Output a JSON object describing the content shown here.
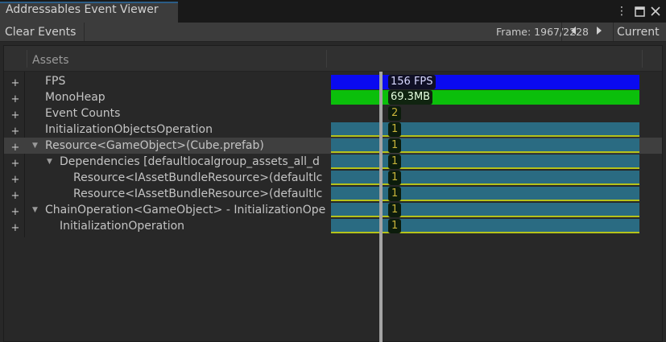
{
  "window": {
    "title": "Addressables Event Viewer",
    "menu_icon": "kebab-menu-icon",
    "maximize_icon": "maximize-icon",
    "close_icon": "close-icon"
  },
  "toolbar": {
    "clear_label": "Clear Events",
    "frame_label": "Frame: 1967/2228",
    "prev_icon": "chevron-left-icon",
    "next_icon": "chevron-right-icon",
    "current_label": "Current"
  },
  "tree": {
    "column_header": "Assets",
    "expand_symbol": "+",
    "rows": [
      {
        "label": "FPS",
        "bar_text": "156 FPS"
      },
      {
        "label": "MonoHeap",
        "bar_text": "69.3MB"
      },
      {
        "label": "Event Counts",
        "bar_text": "2"
      },
      {
        "label": "InitializationObjectsOperation",
        "bar_text": "1"
      },
      {
        "label": "Resource<GameObject>(Cube.prefab)",
        "bar_text": "1"
      },
      {
        "label": "Dependencies [defaultlocalgroup_assets_all_d",
        "bar_text": "1"
      },
      {
        "label": "Resource<IAssetBundleResource>(defaultlc",
        "bar_text": "1"
      },
      {
        "label": "Resource<IAssetBundleResource>(defaultlc",
        "bar_text": "1"
      },
      {
        "label": "ChainOperation<GameObject> - InitializationOpe",
        "bar_text": "1"
      },
      {
        "label": "InitializationOperation",
        "bar_text": "1"
      }
    ]
  },
  "colors": {
    "fps_bar": "#0a0af0",
    "heap_bar": "#0bbf0b",
    "operation_bar": "#2a6b82",
    "operation_underline": "#b5c21a",
    "tab_accent": "#2c5d87"
  }
}
